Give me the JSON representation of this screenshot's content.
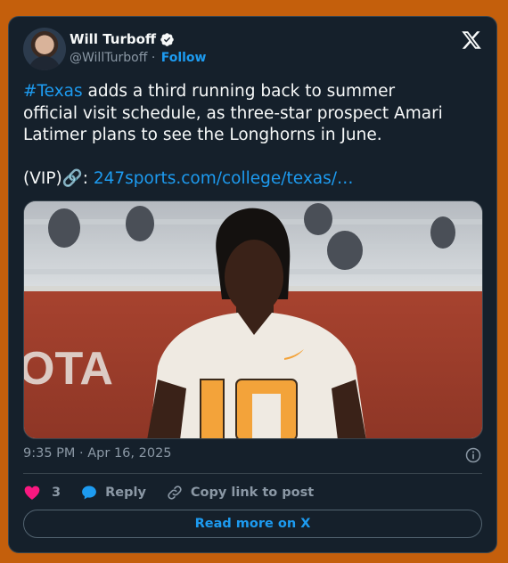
{
  "author": {
    "name": "Will Turboff",
    "handle": "@WillTurboff",
    "separator": "·",
    "follow_label": "Follow"
  },
  "tweet": {
    "hashtag": "#Texas",
    "line1_rest": " adds a third running back to summer",
    "line2": "official visit schedule, as three-star prospect Amari",
    "line3": "Latimer plans to see the Longhorns in June.",
    "vip_prefix": "(VIP)🔗: ",
    "link_text": "247sports.com/college/texas/…"
  },
  "media": {
    "jersey_number": "10",
    "banner_text": "OTA"
  },
  "meta": {
    "timestamp": "9:35 PM · Apr 16, 2025"
  },
  "actions": {
    "like_count": "3",
    "reply_label": "Reply",
    "copy_label": "Copy link to post"
  },
  "footer": {
    "read_more_label": "Read more on X"
  },
  "colors": {
    "card_bg": "#15202b",
    "page_bg": "#c45f0c",
    "accent": "#1d9bf0",
    "like": "#f91880"
  },
  "icons": [
    "verified-badge-icon",
    "x-logo-icon",
    "info-icon",
    "heart-icon",
    "reply-bubble-icon",
    "link-icon"
  ]
}
